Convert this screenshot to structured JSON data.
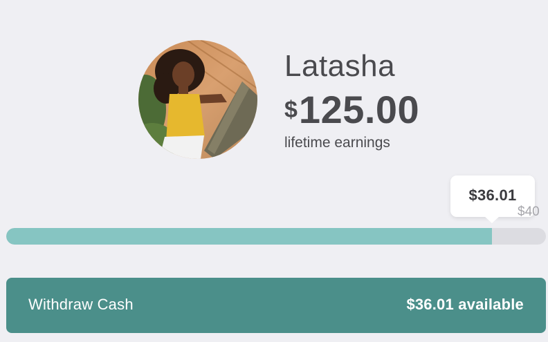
{
  "profile": {
    "name": "Latasha",
    "currency_symbol": "$",
    "lifetime_earnings": "125.00",
    "earnings_caption": "lifetime earnings",
    "avatar_icon": "profile-photo"
  },
  "progress": {
    "current_label": "$36.01",
    "goal_label": "$40",
    "current_value": 36.01,
    "goal_value": 40,
    "fill_color": "#86c5c2",
    "track_color": "#dcdce1"
  },
  "withdraw": {
    "label": "Withdraw Cash",
    "available_label": "$36.01 available",
    "color": "#4b8f8a"
  }
}
